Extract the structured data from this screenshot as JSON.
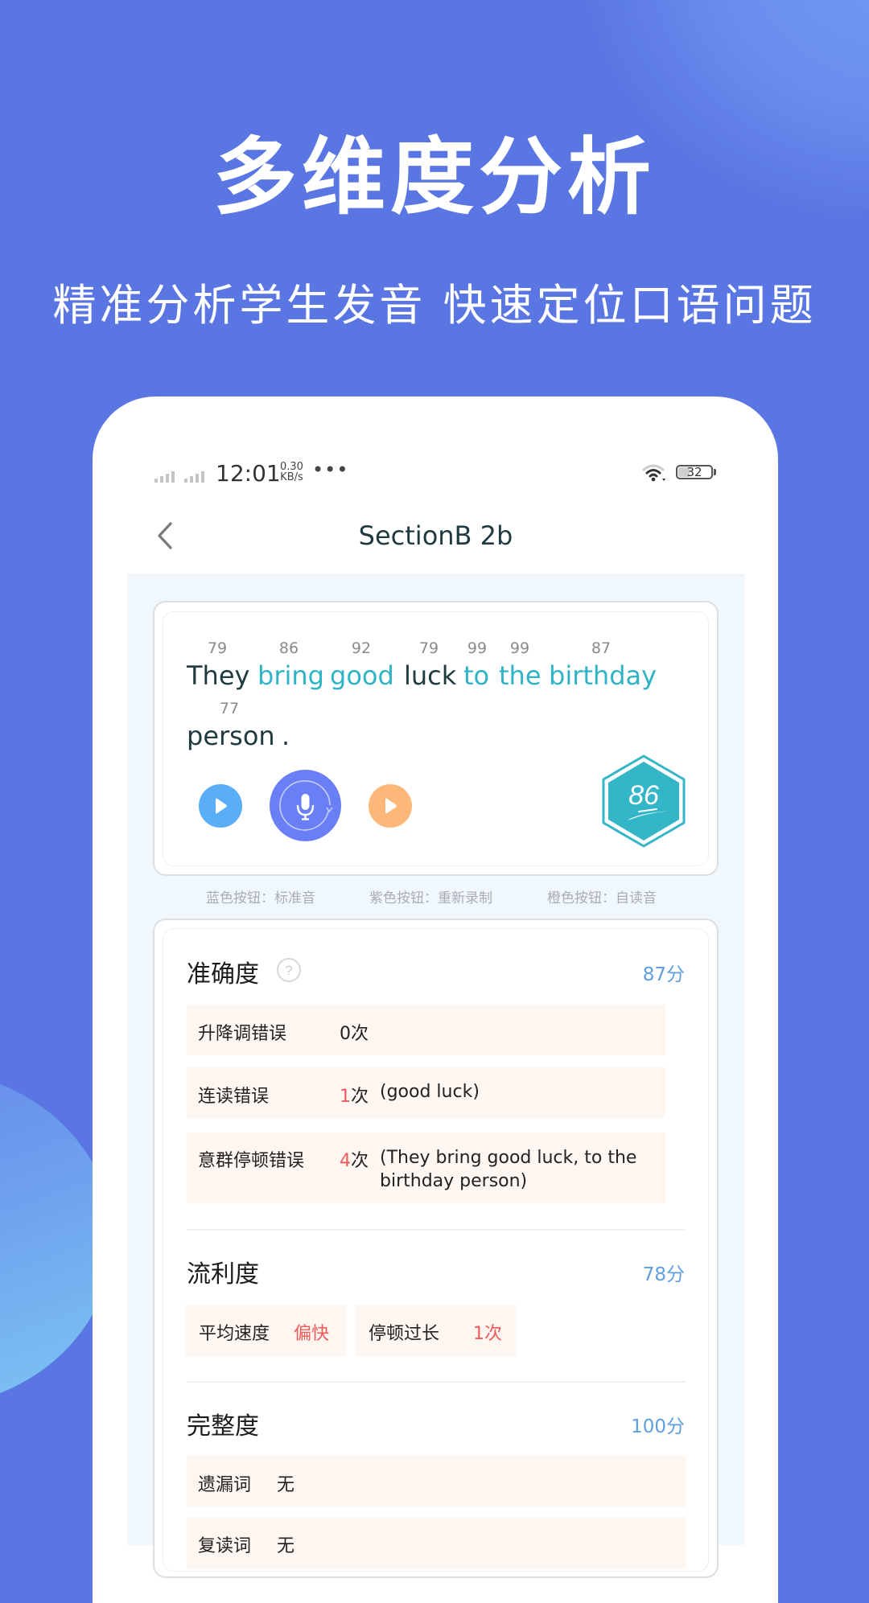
{
  "hero": {
    "title": "多维度分析",
    "subtitle": "精准分析学生发音 快速定位口语问题"
  },
  "status_bar": {
    "time": "12:01",
    "speed_value": "0.30",
    "speed_unit": "KB/s",
    "more": "•••",
    "battery": "32"
  },
  "nav": {
    "back_icon": "chevron-left-icon",
    "title": "SectionB 2b"
  },
  "sentence": {
    "words": [
      {
        "text": "They",
        "score": "79",
        "status": "bad"
      },
      {
        "text": "bring",
        "score": "86",
        "status": "good"
      },
      {
        "text": "good",
        "score": "92",
        "status": "good"
      },
      {
        "text": "luck",
        "score": "79",
        "status": "bad"
      },
      {
        "text": "to",
        "score": "99",
        "status": "good"
      },
      {
        "text": "the",
        "score": "99",
        "status": "good"
      },
      {
        "text": "birthday",
        "score": "87",
        "status": "good"
      },
      {
        "text": "person",
        "score": "77",
        "status": "bad"
      },
      {
        "text": ".",
        "score": "",
        "status": "bad"
      }
    ],
    "total_score": "86",
    "colors": {
      "good": "#2fb3c6",
      "bad": "#1f3a40"
    }
  },
  "controls": {
    "standard_play": {
      "icon": "play-icon",
      "color": "#5aaef8"
    },
    "rerecord": {
      "icon": "microphone-icon",
      "color": "#6a7ef5"
    },
    "self_play": {
      "icon": "play-icon",
      "color": "#fdb879"
    }
  },
  "hints": [
    "蓝色按钮：标准音",
    "紫色按钮：重新录制",
    "橙色按钮：自读音"
  ],
  "sections": {
    "accuracy": {
      "title": "准确度",
      "help_icon": "question-circle-icon",
      "score": "87分",
      "rows": [
        {
          "label": "升降调错误",
          "count": "0",
          "unit": "次",
          "detail": ""
        },
        {
          "label": "连读错误",
          "count": "1",
          "unit": "次",
          "detail": "(good luck)"
        },
        {
          "label": "意群停顿错误",
          "count": "4",
          "unit": "次",
          "detail": "(They bring  good luck, to the birthday person)"
        }
      ]
    },
    "fluency": {
      "title": "流利度",
      "score": "78分",
      "chips": [
        {
          "label": "平均速度",
          "value": "偏快"
        },
        {
          "label": "停顿过长",
          "value": "1次"
        }
      ]
    },
    "completeness": {
      "title": "完整度",
      "score": "100分",
      "rows": [
        {
          "label": "遗漏词",
          "value": "无"
        },
        {
          "label": "复读词",
          "value": "无"
        }
      ]
    }
  }
}
